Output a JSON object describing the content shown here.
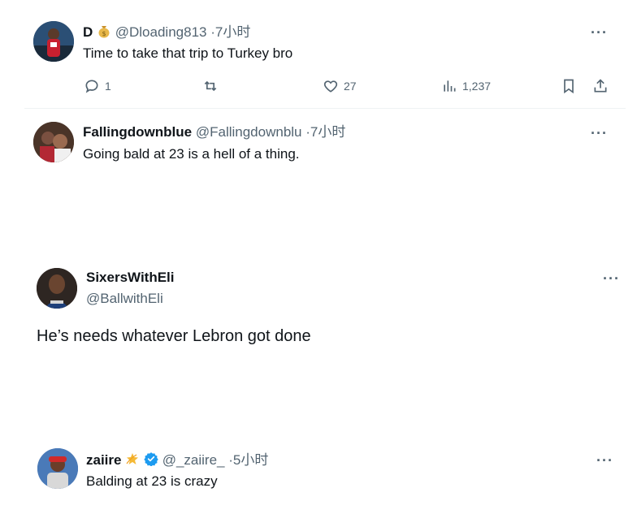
{
  "tweets": [
    {
      "display_name": "D",
      "emoji": "money-bag",
      "handle": "@Dloading813",
      "separator": "·",
      "time": "7小时",
      "text": "Time to take that trip to Turkey bro",
      "replies": "1",
      "likes": "27",
      "views": "1,237"
    },
    {
      "display_name": "Fallingdownblue",
      "handle": "@Fallingdownblu",
      "separator": "·",
      "time": "7小时",
      "text": "Going bald at 23 is a hell of a thing."
    },
    {
      "display_name": "SixersWithEli",
      "handle": "@BallwithEli",
      "text": "He’s needs whatever Lebron got done"
    },
    {
      "display_name": "zaiire",
      "emoji": "dizzy-star",
      "verified": true,
      "handle": "@_zaiire_",
      "separator": "·",
      "time": "5小时",
      "text": "Balding at 23 is crazy"
    }
  ],
  "more_label": "···",
  "colors": {
    "text": "#0f1419",
    "secondary": "#536471",
    "divider": "#eff3f4",
    "verified": "#1d9bf0"
  }
}
